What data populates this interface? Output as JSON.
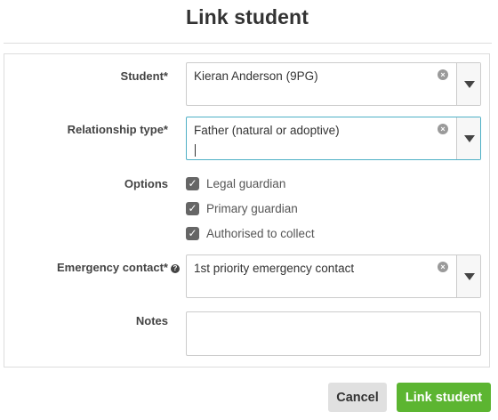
{
  "dialog": {
    "title": "Link student"
  },
  "fields": {
    "student": {
      "label": "Student*",
      "value": "Kieran Anderson (9PG)"
    },
    "relationship": {
      "label": "Relationship type*",
      "value": "Father (natural or adoptive)"
    },
    "options": {
      "label": "Options",
      "items": [
        {
          "label": "Legal guardian",
          "checked": true
        },
        {
          "label": "Primary guardian",
          "checked": true
        },
        {
          "label": "Authorised to collect",
          "checked": true
        }
      ]
    },
    "emergency": {
      "label": "Emergency contact*",
      "value": "1st priority emergency contact"
    },
    "notes": {
      "label": "Notes",
      "value": ""
    }
  },
  "buttons": {
    "cancel": "Cancel",
    "link": "Link student"
  },
  "icons": {
    "clear": "clear-icon",
    "dropdown": "chevron-down-icon",
    "help": "help-icon",
    "check": "checkmark-icon"
  },
  "colors": {
    "primary_button": "#5cb531",
    "focus_border": "#4fb0c6",
    "checkbox": "#666666"
  }
}
